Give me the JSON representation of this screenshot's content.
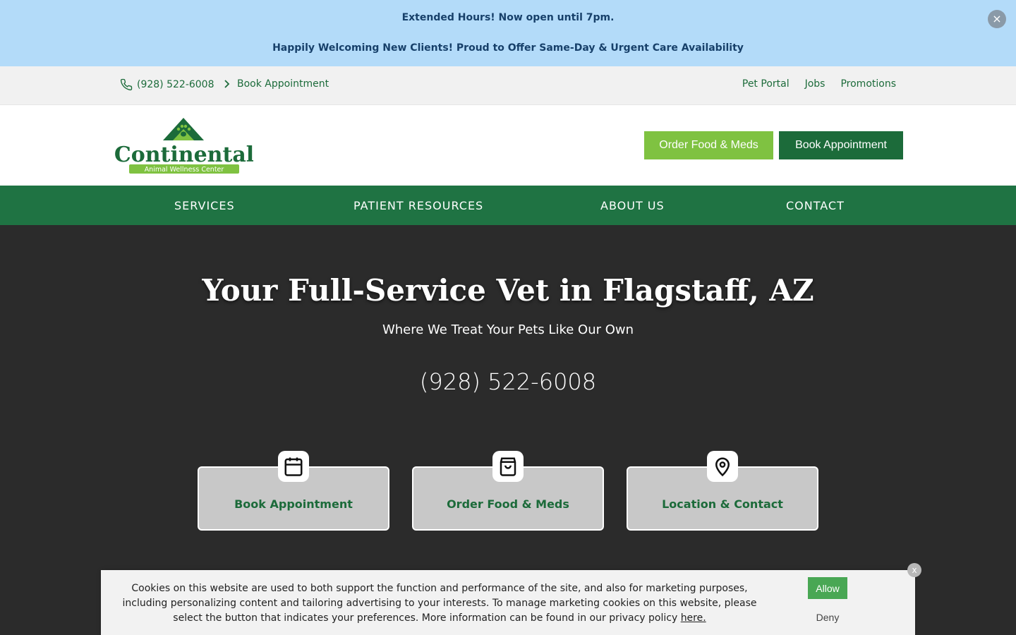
{
  "announcement": {
    "line1": "Extended Hours! Now open until 7pm.",
    "line2": "Happily Welcoming New Clients! Proud to Offer Same-Day & Urgent Care Availability",
    "close_icon": "×"
  },
  "utility": {
    "phone": "(928) 522-6008",
    "book": "Book Appointment",
    "links": [
      "Pet Portal",
      "Jobs",
      "Promotions"
    ]
  },
  "header": {
    "logo_text": "Continental",
    "logo_subtext": "Animal Wellness Center",
    "order_button": "Order Food & Meds",
    "book_button": "Book Appointment"
  },
  "nav": [
    "SERVICES",
    "PATIENT RESOURCES",
    "ABOUT US",
    "CONTACT"
  ],
  "hero": {
    "title": "Your Full-Service Vet in Flagstaff, AZ",
    "subtitle": "Where We Treat Your Pets Like Our Own",
    "phone": "(928) 522-6008"
  },
  "cards": [
    {
      "label": "Book Appointment",
      "icon": "calendar-icon"
    },
    {
      "label": "Order Food & Meds",
      "icon": "shopping-bag-icon"
    },
    {
      "label": "Location & Contact",
      "icon": "map-pin-icon"
    }
  ],
  "cookie": {
    "text_line1": "Cookies on this website are used to both support the function and performance of the site, and also for marketing purposes,",
    "text_line2": "including personalizing content and tailoring advertising to your interests. To manage marketing cookies on this website, please",
    "text_line3": "select the button that indicates your preferences. More information can be found in our privacy policy ",
    "link": "here.",
    "allow": "Allow",
    "deny": "Deny",
    "close": "x"
  },
  "colors": {
    "brand_green": "#1c6b3a",
    "nav_green": "#1f7343",
    "accent_green": "#7fc241",
    "announce_bg": "#b3dbf9",
    "hero_bg": "#2b2b2b"
  }
}
